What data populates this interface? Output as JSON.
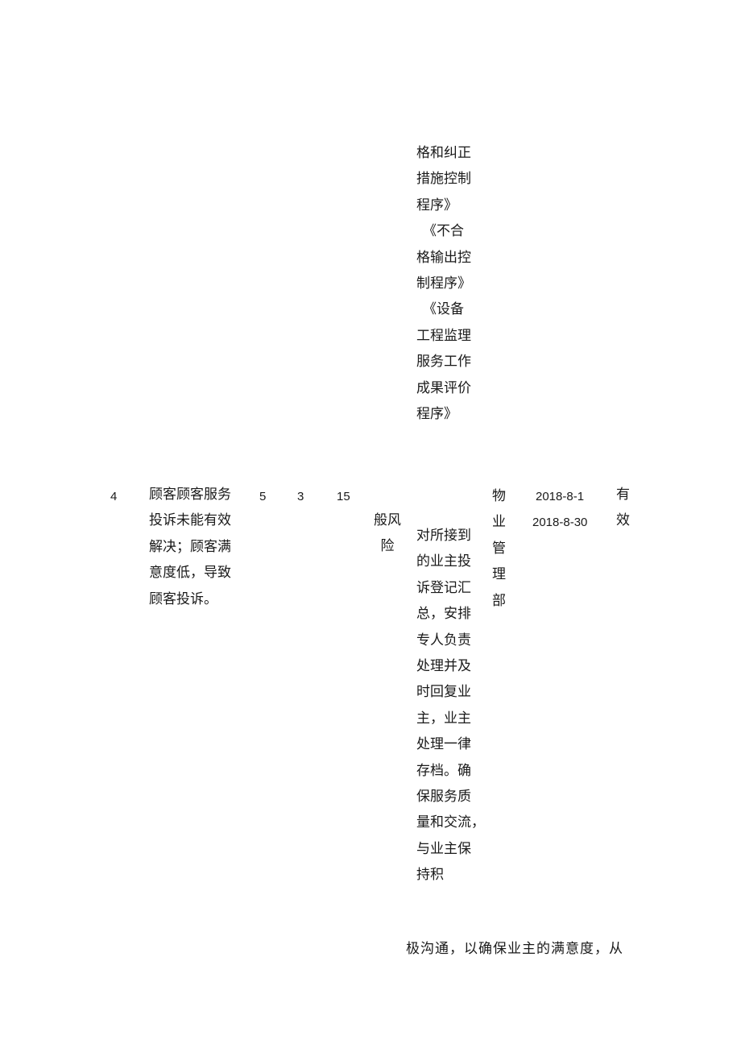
{
  "top_block": {
    "procedure_lines": [
      "格和纠正",
      "措施控制",
      "程序》",
      "《不合",
      "格输出控",
      "制程序》",
      "《设备",
      "工程监理",
      "服务工作",
      "成果评价",
      "程序》"
    ]
  },
  "row": {
    "index": "4",
    "risk_description_lines": [
      "顾客顾客服务",
      "投诉未能有效",
      "解决；顾客满",
      "意度低，导致",
      "顾客投诉。"
    ],
    "severity": "5",
    "probability": "3",
    "score": "15",
    "risk_level_lines": [
      "般风",
      "险"
    ],
    "measures_lines": [
      "对所接到",
      "的业主投",
      "诉登记汇",
      "总，安排",
      "专人负责",
      "处理并及",
      "时回复业",
      "主，业主",
      "处理一律",
      "存档。确",
      "保服务质",
      "量和交流，",
      "与业主保",
      "持积"
    ],
    "department_lines": [
      "物",
      "业",
      "管",
      "理",
      "部"
    ],
    "start_date": "2018-8-1",
    "end_date": "2018-8-30",
    "status_lines": [
      "有",
      "效"
    ]
  },
  "continuation": {
    "text": "极沟通，以确保业主的满意度，从"
  }
}
